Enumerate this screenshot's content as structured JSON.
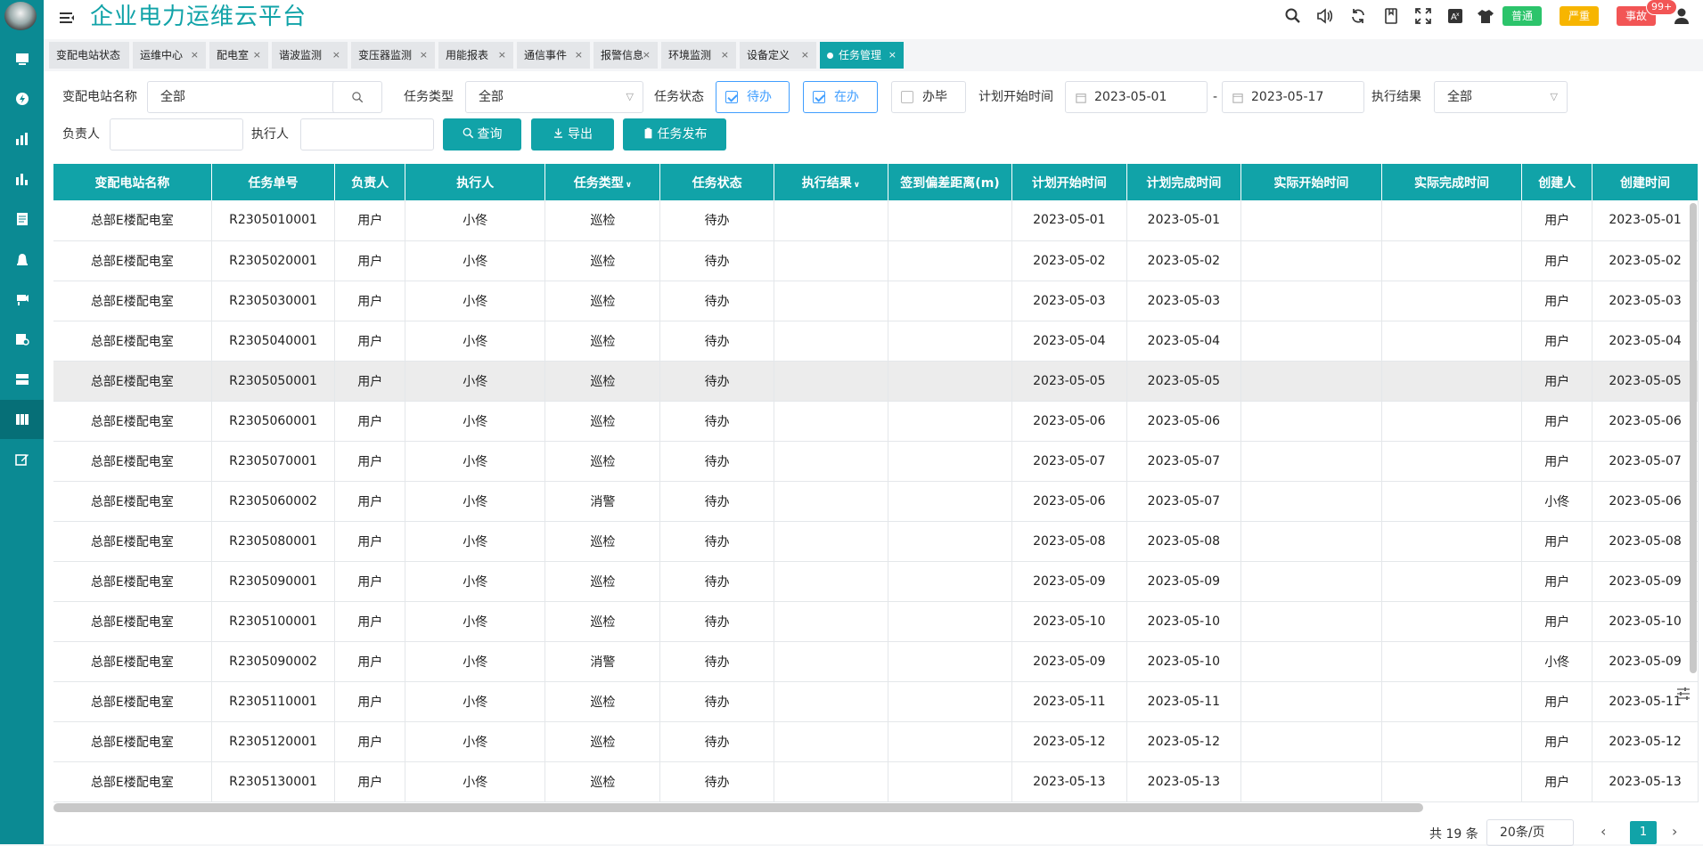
{
  "header": {
    "title": "企业电力运维云平台",
    "severity_buttons": [
      {
        "label": "普通",
        "color": "#2cc46b"
      },
      {
        "label": "严重",
        "color": "#f7b500"
      },
      {
        "label": "事故",
        "color": "#f25555"
      }
    ],
    "alarm_count": "99+"
  },
  "sidebar": {
    "icons": [
      "dashboard-icon",
      "energy-icon",
      "bar-chart-icon",
      "stats-icon",
      "report-icon",
      "alarm-icon",
      "camera-icon",
      "inspection-icon",
      "device-icon",
      "task-icon",
      "edit-icon"
    ],
    "active_index": 9
  },
  "tabs": [
    {
      "label": "变配电站状态",
      "closable": false
    },
    {
      "label": "运维中心",
      "closable": true
    },
    {
      "label": "配电室",
      "closable": true
    },
    {
      "label": "谐波监测",
      "closable": true
    },
    {
      "label": "变压器监测",
      "closable": true
    },
    {
      "label": "用能报表",
      "closable": true
    },
    {
      "label": "通信事件",
      "closable": true
    },
    {
      "label": "报警信息",
      "closable": true
    },
    {
      "label": "环境监测",
      "closable": true
    },
    {
      "label": "设备定义",
      "closable": true
    },
    {
      "label": "任务管理",
      "closable": true,
      "active": true
    }
  ],
  "filters": {
    "station_label": "变配电站名称",
    "station_value": "全部",
    "task_type_label": "任务类型",
    "task_type_value": "全部",
    "task_status_label": "任务状态",
    "status_options": [
      {
        "label": "待办",
        "checked": true
      },
      {
        "label": "在办",
        "checked": true
      },
      {
        "label": "办毕",
        "checked": false
      }
    ],
    "plan_start_label": "计划开始时间",
    "date_from": "2023-05-01",
    "date_sep": "-",
    "date_to": "2023-05-17",
    "result_label": "执行结果",
    "result_value": "全部",
    "owner_label": "负责人",
    "owner_value": "",
    "executor_label": "执行人",
    "executor_value": "",
    "query_button": "查询",
    "export_button": "导出",
    "publish_button": "任务发布"
  },
  "table": {
    "columns": [
      "变配电站名称",
      "任务单号",
      "负责人",
      "执行人",
      "任务类型",
      "任务状态",
      "执行结果",
      "签到偏差距离(m)",
      "计划开始时间",
      "计划完成时间",
      "实际开始时间",
      "实际完成时间",
      "创建人",
      "创建时间"
    ],
    "sortable_columns": [
      4,
      6
    ],
    "highlight_row": 4,
    "rows": [
      [
        "总部E楼配电室",
        "R2305010001",
        "用户",
        "小佟",
        "巡检",
        "待办",
        "",
        "",
        "2023-05-01",
        "2023-05-01",
        "",
        "",
        "用户",
        "2023-05-01"
      ],
      [
        "总部E楼配电室",
        "R2305020001",
        "用户",
        "小佟",
        "巡检",
        "待办",
        "",
        "",
        "2023-05-02",
        "2023-05-02",
        "",
        "",
        "用户",
        "2023-05-02"
      ],
      [
        "总部E楼配电室",
        "R2305030001",
        "用户",
        "小佟",
        "巡检",
        "待办",
        "",
        "",
        "2023-05-03",
        "2023-05-03",
        "",
        "",
        "用户",
        "2023-05-03"
      ],
      [
        "总部E楼配电室",
        "R2305040001",
        "用户",
        "小佟",
        "巡检",
        "待办",
        "",
        "",
        "2023-05-04",
        "2023-05-04",
        "",
        "",
        "用户",
        "2023-05-04"
      ],
      [
        "总部E楼配电室",
        "R2305050001",
        "用户",
        "小佟",
        "巡检",
        "待办",
        "",
        "",
        "2023-05-05",
        "2023-05-05",
        "",
        "",
        "用户",
        "2023-05-05"
      ],
      [
        "总部E楼配电室",
        "R2305060001",
        "用户",
        "小佟",
        "巡检",
        "待办",
        "",
        "",
        "2023-05-06",
        "2023-05-06",
        "",
        "",
        "用户",
        "2023-05-06"
      ],
      [
        "总部E楼配电室",
        "R2305070001",
        "用户",
        "小佟",
        "巡检",
        "待办",
        "",
        "",
        "2023-05-07",
        "2023-05-07",
        "",
        "",
        "用户",
        "2023-05-07"
      ],
      [
        "总部E楼配电室",
        "R2305060002",
        "用户",
        "小佟",
        "消警",
        "待办",
        "",
        "",
        "2023-05-06",
        "2023-05-07",
        "",
        "",
        "小佟",
        "2023-05-06"
      ],
      [
        "总部E楼配电室",
        "R2305080001",
        "用户",
        "小佟",
        "巡检",
        "待办",
        "",
        "",
        "2023-05-08",
        "2023-05-08",
        "",
        "",
        "用户",
        "2023-05-08"
      ],
      [
        "总部E楼配电室",
        "R2305090001",
        "用户",
        "小佟",
        "巡检",
        "待办",
        "",
        "",
        "2023-05-09",
        "2023-05-09",
        "",
        "",
        "用户",
        "2023-05-09"
      ],
      [
        "总部E楼配电室",
        "R2305100001",
        "用户",
        "小佟",
        "巡检",
        "待办",
        "",
        "",
        "2023-05-10",
        "2023-05-10",
        "",
        "",
        "用户",
        "2023-05-10"
      ],
      [
        "总部E楼配电室",
        "R2305090002",
        "用户",
        "小佟",
        "消警",
        "待办",
        "",
        "",
        "2023-05-09",
        "2023-05-10",
        "",
        "",
        "小佟",
        "2023-05-09"
      ],
      [
        "总部E楼配电室",
        "R2305110001",
        "用户",
        "小佟",
        "巡检",
        "待办",
        "",
        "",
        "2023-05-11",
        "2023-05-11",
        "",
        "",
        "用户",
        "2023-05-11"
      ],
      [
        "总部E楼配电室",
        "R2305120001",
        "用户",
        "小佟",
        "巡检",
        "待办",
        "",
        "",
        "2023-05-12",
        "2023-05-12",
        "",
        "",
        "用户",
        "2023-05-12"
      ],
      [
        "总部E楼配电室",
        "R2305130001",
        "用户",
        "小佟",
        "巡检",
        "待办",
        "",
        "",
        "2023-05-13",
        "2023-05-13",
        "",
        "",
        "用户",
        "2023-05-13"
      ]
    ]
  },
  "pagination": {
    "total": "共 19 条",
    "page_size": "20条/页",
    "current_page": "1",
    "prev": "‹",
    "next": "›"
  }
}
